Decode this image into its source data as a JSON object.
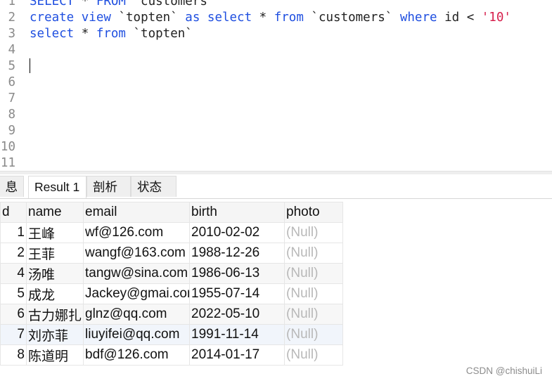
{
  "editor": {
    "lines": [
      {
        "num": "1",
        "tokens": [
          {
            "t": "SELECT",
            "k": "kw"
          },
          {
            "t": " * ",
            "k": "op"
          },
          {
            "t": "FROM",
            "k": "kw"
          },
          {
            "t": " `customers`",
            "k": "id"
          }
        ]
      },
      {
        "num": "2",
        "tokens": [
          {
            "t": "create",
            "k": "kw"
          },
          {
            "t": " ",
            "k": "op"
          },
          {
            "t": "view",
            "k": "kw"
          },
          {
            "t": " `topten` ",
            "k": "id"
          },
          {
            "t": "as",
            "k": "kw"
          },
          {
            "t": " ",
            "k": "op"
          },
          {
            "t": "select",
            "k": "kw"
          },
          {
            "t": " * ",
            "k": "op"
          },
          {
            "t": "from",
            "k": "kw"
          },
          {
            "t": " `customers` ",
            "k": "id"
          },
          {
            "t": "where",
            "k": "kw"
          },
          {
            "t": " id < ",
            "k": "id"
          },
          {
            "t": "'10'",
            "k": "str"
          }
        ]
      },
      {
        "num": "3",
        "tokens": [
          {
            "t": "select",
            "k": "kw"
          },
          {
            "t": " * ",
            "k": "op"
          },
          {
            "t": "from",
            "k": "kw"
          },
          {
            "t": " `topten`",
            "k": "id"
          }
        ]
      },
      {
        "num": "4",
        "tokens": []
      },
      {
        "num": "5",
        "tokens": []
      },
      {
        "num": "6",
        "tokens": []
      },
      {
        "num": "7",
        "tokens": []
      },
      {
        "num": "8",
        "tokens": []
      },
      {
        "num": "9",
        "tokens": []
      },
      {
        "num": "10",
        "tokens": []
      },
      {
        "num": "11",
        "tokens": []
      }
    ]
  },
  "tabs": {
    "info": "息",
    "result": "Result 1",
    "profile": "剖析",
    "status": "状态"
  },
  "grid": {
    "headers": {
      "id": "d",
      "name": "name",
      "email": "email",
      "birth": "birth",
      "photo": "photo"
    },
    "rows": [
      {
        "id": "1",
        "name": "王峰",
        "email": "wf@126.com",
        "birth": "2010-02-02",
        "photo": "(Null)"
      },
      {
        "id": "2",
        "name": "王菲",
        "email": "wangf@163.com",
        "birth": "1988-12-26",
        "photo": "(Null)"
      },
      {
        "id": "4",
        "name": "汤唯",
        "email": "tangw@sina.com",
        "birth": "1986-06-13",
        "photo": "(Null)"
      },
      {
        "id": "5",
        "name": "成龙",
        "email": "Jackey@gmai.com",
        "birth": "1955-07-14",
        "photo": "(Null)"
      },
      {
        "id": "6",
        "name": "古力娜扎",
        "email": "glnz@qq.com",
        "birth": "2022-05-10",
        "photo": "(Null)"
      },
      {
        "id": "7",
        "name": "刘亦菲",
        "email": "liuyifei@qq.com",
        "birth": "1991-11-14",
        "photo": "(Null)"
      },
      {
        "id": "8",
        "name": "陈道明",
        "email": "bdf@126.com",
        "birth": "2014-01-17",
        "photo": "(Null)"
      }
    ]
  },
  "watermark": "CSDN @chishuiLi"
}
